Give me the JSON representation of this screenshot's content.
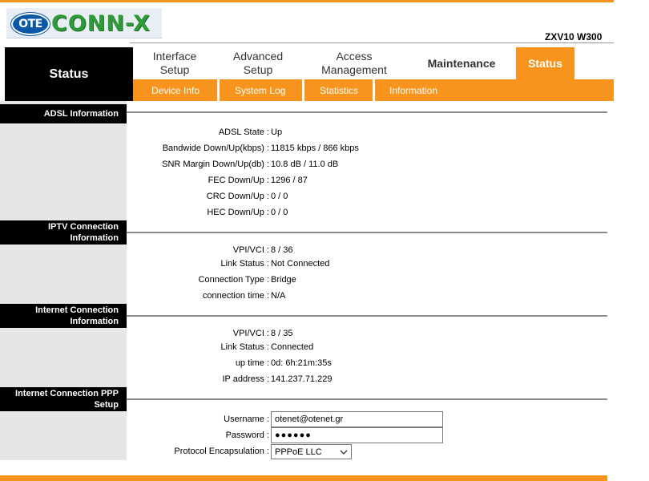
{
  "header": {
    "logo_ote": "OTE",
    "logo_text": "CONN-X",
    "model": "ZXV10 W300"
  },
  "nav": {
    "current_section": "Status",
    "tabs": [
      {
        "label_line1": "Interface",
        "label_line2": "Setup"
      },
      {
        "label_line1": "Advanced",
        "label_line2": "Setup"
      },
      {
        "label_line1": "Access",
        "label_line2": "Management"
      },
      {
        "label_line1": "Maintenance",
        "label_line2": ""
      },
      {
        "label_line1": "Status",
        "label_line2": "",
        "active": true
      }
    ],
    "subtabs": [
      "Device Info",
      "System Log",
      "Statistics",
      "Information"
    ]
  },
  "adsl": {
    "title": "ADSL Information",
    "rows": [
      {
        "label": "ADSL State :",
        "value": "Up"
      },
      {
        "label": "Bandwide Down/Up(kbps) :",
        "value": "11815 kbps / 866 kbps"
      },
      {
        "label": "SNR Margin Down/Up(db) :",
        "value": "10.8 dB / 11.0 dB"
      },
      {
        "label": "FEC Down/Up :",
        "value": "1296 / 87"
      },
      {
        "label": "CRC Down/Up :",
        "value": "0 / 0"
      },
      {
        "label": "HEC Down/Up :",
        "value": "0 / 0"
      }
    ]
  },
  "iptv": {
    "title_line1": "IPTV Connection",
    "title_line2": "Information",
    "rows": [
      {
        "label": "VPI/VCI :",
        "value": "8 / 36"
      },
      {
        "label": "Link Status :",
        "value": "Not Connected"
      },
      {
        "label": "Connection Type :",
        "value": "Bridge"
      },
      {
        "label": "connection time :",
        "value": "N/A"
      }
    ]
  },
  "internet": {
    "title_line1": "Internet Connection",
    "title_line2": "Information",
    "rows": [
      {
        "label": "VPI/VCI :",
        "value": "8 / 35"
      },
      {
        "label": "Link Status :",
        "value": "Connected"
      },
      {
        "label": "up time :",
        "value": "0d: 6h:21m:35s"
      },
      {
        "label": "IP address :",
        "value": "141.237.71.229"
      }
    ]
  },
  "ppp": {
    "title_line1": "Internet Connection PPP",
    "title_line2": "Setup",
    "username_label": "Username :",
    "username_value": "otenet@otenet.gr",
    "password_label": "Password :",
    "password_value": "●●●●●●",
    "encap_label": "Protocol Encapsulation :",
    "encap_value": "PPPoE LLC"
  },
  "colors": {
    "accent": "#f7941d",
    "header_bg": "#000000",
    "sidebar_bg": "#e6e6e6"
  }
}
